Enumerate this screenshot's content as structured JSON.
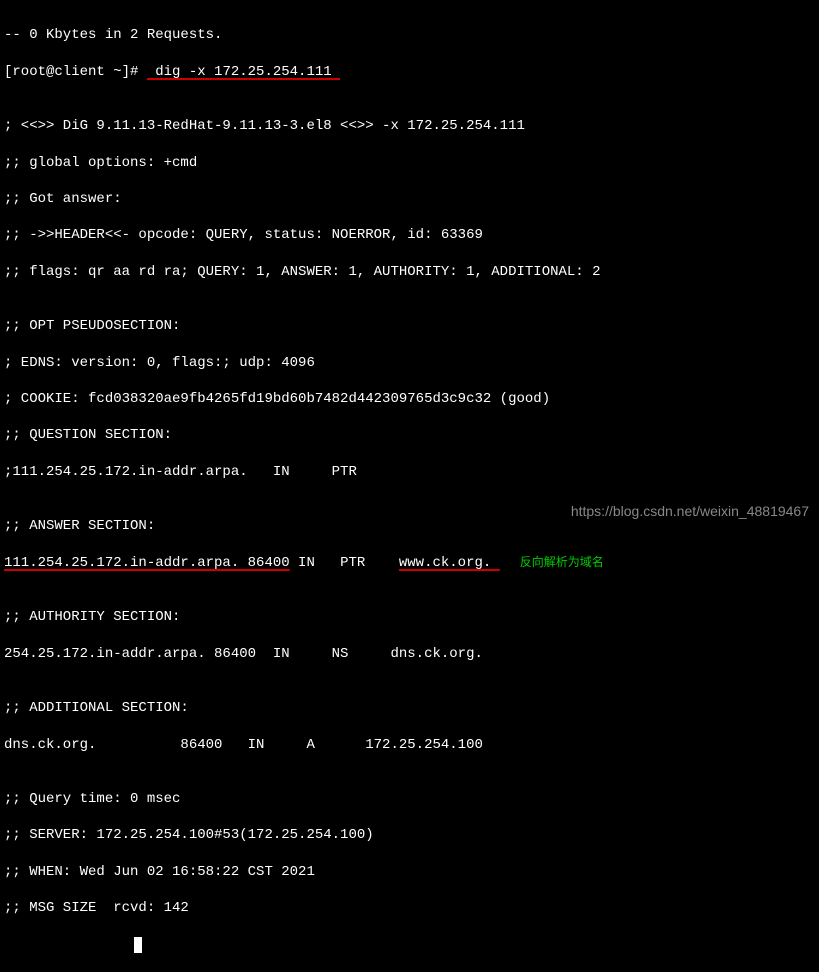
{
  "terminal": {
    "line1": "-- 0 Kbytes in 2 Requests.",
    "prompt": "[root@client ~]# ",
    "command": " dig -x 172.25.254.111 ",
    "blank1": "",
    "line3": "; <<>> DiG 9.11.13-RedHat-9.11.13-3.el8 <<>> -x 172.25.254.111",
    "line4": ";; global options: +cmd",
    "line5": ";; Got answer:",
    "line6": ";; ->>HEADER<<- opcode: QUERY, status: NOERROR, id: 63369",
    "line7": ";; flags: qr aa rd ra; QUERY: 1, ANSWER: 1, AUTHORITY: 1, ADDITIONAL: 2",
    "blank2": "",
    "line8": ";; OPT PSEUDOSECTION:",
    "line9": "; EDNS: version: 0, flags:; udp: 4096",
    "line10": "; COOKIE: fcd038320ae9fb4265fd19bd60b7482d442309765d3c9c32 (good)",
    "line11": ";; QUESTION SECTION:",
    "line12": ";111.254.25.172.in-addr.arpa.   IN     PTR",
    "blank3": "",
    "line13": ";; ANSWER SECTION:",
    "answer_part1": "111.254.25.172.in-addr.arpa. 86400",
    "answer_mid": " IN   PTR    ",
    "answer_part2": "www.ck.org. ",
    "annotation": "反向解析为域名",
    "blank4": "",
    "line15": ";; AUTHORITY SECTION:",
    "line16": "254.25.172.in-addr.arpa. 86400  IN     NS     dns.ck.org.",
    "blank5": "",
    "line17": ";; ADDITIONAL SECTION:",
    "line18": "dns.ck.org.          86400   IN     A      172.25.254.100",
    "blank6": "",
    "line19": ";; Query time: 0 msec",
    "line20": ";; SERVER: 172.25.254.100#53(172.25.254.100)",
    "line21": ";; WHEN: Wed Jun 02 16:58:22 CST 2021",
    "line22": ";; MSG SIZE  rcvd: 142"
  },
  "watermark": "https://blog.csdn.net/weixin_48819467"
}
